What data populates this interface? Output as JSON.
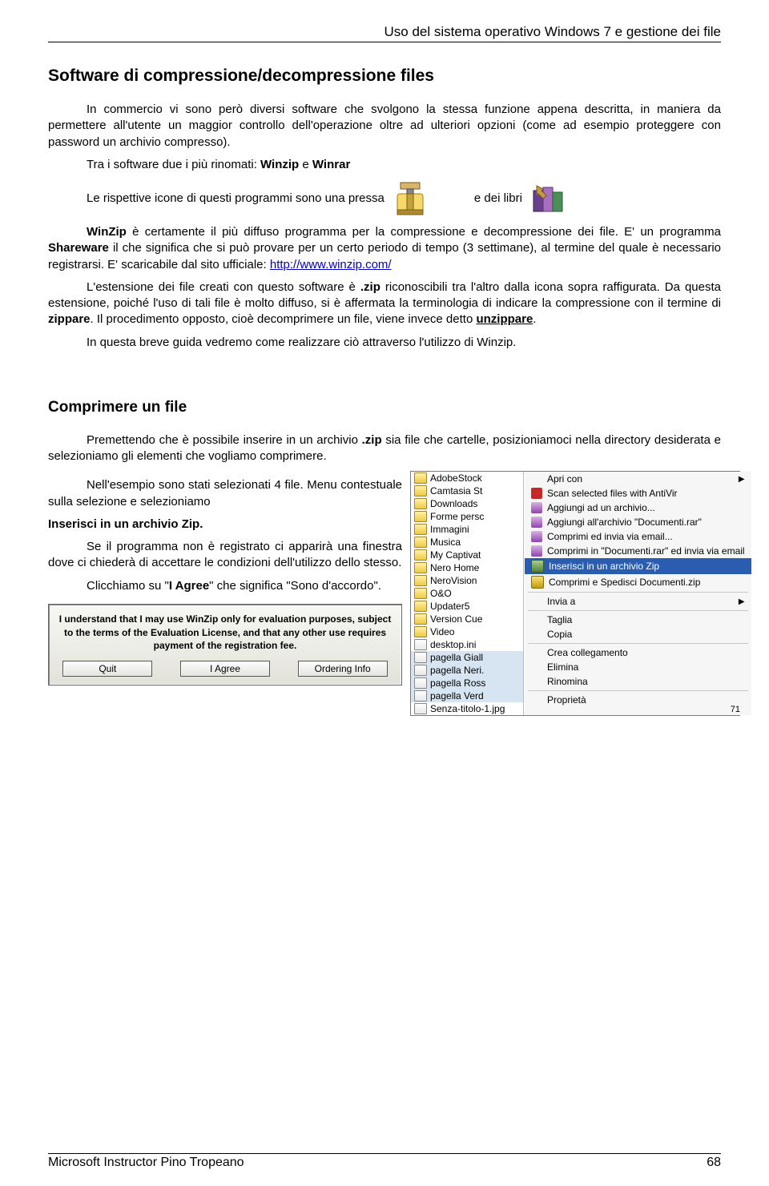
{
  "header": "Uso del sistema operativo Windows 7 e gestione dei file",
  "section_title": "Software di compressione/decompressione files",
  "p1": "In commercio vi sono però diversi software che svolgono la stessa funzione appena descritta, in maniera da permettere all'utente un maggior controllo dell'operazione oltre ad ulteriori opzioni (come ad esempio proteggere con password un archivio compresso).",
  "p2a": "Tra i software due i più rinomati: ",
  "p2b_bold1": "Winzip",
  "p2c": " e ",
  "p2d_bold2": "Winrar",
  "icons_pre": "Le rispettive icone di questi programmi sono una pressa",
  "icons_mid": " e dei libri",
  "p3a_bold": "WinZip",
  "p3b": " è certamente il più diffuso programma per la compressione e decompressione dei file. E' un programma ",
  "p3c_bold": "Shareware",
  "p3d": " il che significa che si può provare per un certo periodo di tempo (3 settimane), al termine del quale è necessario registrarsi. E' scaricabile dal sito ufficiale: ",
  "p3_link": "http://www.winzip.com/",
  "p4a": "L'estensione dei file creati con questo software è ",
  "p4b_bold": ".zip",
  "p4c": " riconoscibili tra l'altro dalla icona sopra raffigurata. Da questa estensione, poiché l'uso di tali file è molto diffuso, si è affermata la terminologia di indicare la compressione con il termine di ",
  "p4d_bold": "zippare",
  "p4e": ". Il procedimento opposto, cioè decomprimere un file, viene invece detto ",
  "p4f_bold": "unzippare",
  "p4g": ".",
  "p5": "In questa breve guida vedremo come realizzare ciò attraverso l'utilizzo di Winzip.",
  "sub_title": "Comprimere un file",
  "cp1a": "Premettendo che è possibile inserire in un archivio ",
  "cp1b_bold": ".zip",
  "cp1c": " sia file che cartelle, posizioniamoci nella directory desiderata e selezioniamo gli elementi che vogliamo comprimere.",
  "cp2": "Nell'esempio sono stati selezionati 4 file. Menu contestuale sulla selezione e selezioniamo",
  "cp3_bold": "Inserisci in un archivio Zip.",
  "cp4": "Se il programma non è registrato ci apparirà una finestra dove ci chiederà di accettare le condizioni dell'utilizzo dello stesso.",
  "cp5a": "Clicchiamo su \"",
  "cp5b_bold": "I Agree",
  "cp5c": "\" che significa \"Sono d'accordo\".",
  "ctx_files": [
    {
      "name": "AdobeStock",
      "t": "folder"
    },
    {
      "name": "Camtasia St",
      "t": "folder"
    },
    {
      "name": "Downloads",
      "t": "folder"
    },
    {
      "name": "Forme persc",
      "t": "folder"
    },
    {
      "name": "Immagini",
      "t": "folder"
    },
    {
      "name": "Musica",
      "t": "folder"
    },
    {
      "name": "My Captivat",
      "t": "folder"
    },
    {
      "name": "Nero Home",
      "t": "folder"
    },
    {
      "name": "NeroVision",
      "t": "folder"
    },
    {
      "name": "O&O",
      "t": "folder"
    },
    {
      "name": "Updater5",
      "t": "folder"
    },
    {
      "name": "Version Cue",
      "t": "folder"
    },
    {
      "name": "Video",
      "t": "folder"
    },
    {
      "name": "desktop.ini",
      "t": "file"
    },
    {
      "name": "pagella Giall",
      "t": "file",
      "sel": true
    },
    {
      "name": "pagella Neri.",
      "t": "file",
      "sel": true
    },
    {
      "name": "pagella Ross",
      "t": "file",
      "sel": true
    },
    {
      "name": "pagella Verd",
      "t": "file",
      "sel": true
    },
    {
      "name": "Senza-titolo-1.jpg",
      "t": "file"
    }
  ],
  "ctx_menu": [
    {
      "label": "Apri con",
      "arrow": true
    },
    {
      "label": "Scan selected files with AntiVir",
      "icon": "scan"
    },
    {
      "label": "Aggiungi ad un archivio...",
      "icon": "rar"
    },
    {
      "label": "Aggiungi all'archivio \"Documenti.rar\"",
      "icon": "rar"
    },
    {
      "label": "Comprimi ed invia via email...",
      "icon": "rar"
    },
    {
      "label": "Comprimi in \"Documenti.rar\" ed invia via email",
      "icon": "rar"
    },
    {
      "label": "Inserisci in un archivio Zip",
      "icon": "zipi",
      "sel": true
    },
    {
      "label": "Comprimi e Spedisci Documenti.zip",
      "icon": "zipb"
    },
    {
      "sep": true
    },
    {
      "label": "Invia a",
      "arrow": true
    },
    {
      "sep": true
    },
    {
      "label": "Taglia"
    },
    {
      "label": "Copia"
    },
    {
      "sep": true
    },
    {
      "label": "Crea collegamento"
    },
    {
      "label": "Elimina"
    },
    {
      "label": "Rinomina"
    },
    {
      "sep": true
    },
    {
      "label": "Proprietà"
    }
  ],
  "small_71": "71",
  "dialog": {
    "msg": "I understand that I may use WinZip only for evaluation purposes, subject to the terms of the Evaluation License, and that any other use requires payment of the registration fee.",
    "buttons": [
      "Quit",
      "I Agree",
      "Ordering Info"
    ]
  },
  "footer_left": "Microsoft Instructor Pino Tropeano",
  "footer_right": "68"
}
